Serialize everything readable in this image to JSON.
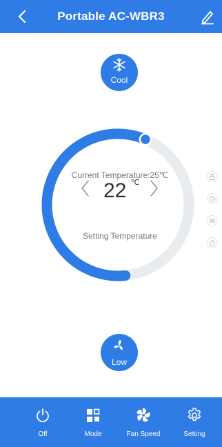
{
  "header": {
    "title": "Portable AC-WBR3",
    "back_icon": "chevron-left-icon",
    "edit_icon": "pencil-icon"
  },
  "mode": {
    "label": "Cool",
    "icon": "snowflake-icon"
  },
  "thermostat": {
    "current_temperature_text": "Current Temperature:25℃",
    "setting_value": "22",
    "unit": "℃",
    "setting_label": "Setting Temperature",
    "progress_fraction": 0.58
  },
  "side_icons": [
    "lock-icon",
    "timer-icon",
    "swing-icon",
    "humidity-drop-icon"
  ],
  "fan": {
    "label": "Low",
    "icon": "fan-icon"
  },
  "tabs": [
    {
      "label": "Off",
      "icon": "power-icon"
    },
    {
      "label": "Mode",
      "icon": "mode-grid-icon"
    },
    {
      "label": "Fan Speed",
      "icon": "fan-speed-icon"
    },
    {
      "label": "Setting",
      "icon": "gear-icon"
    }
  ],
  "colors": {
    "accent": "#2f7ce6",
    "track": "#e8ecef",
    "muted": "#777777"
  }
}
